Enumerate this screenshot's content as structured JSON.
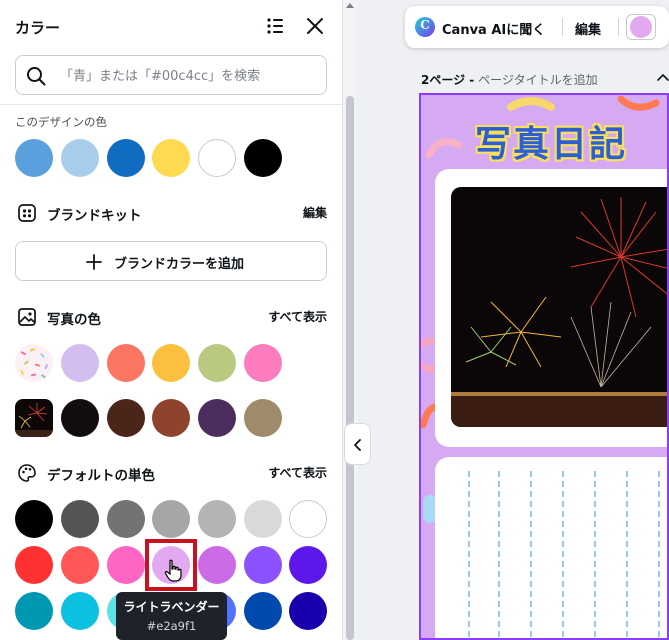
{
  "panel": {
    "title": "カラー",
    "search_placeholder": "「青」または「#00c4cc」を検索",
    "design_colors": {
      "caption": "このデザインの色",
      "colors": [
        "#5aa0dc",
        "#a8cdeb",
        "#0f6cc0",
        "#fdda4f",
        "#ffffff",
        "#000000"
      ]
    },
    "brand_kit": {
      "title": "ブランドキット",
      "edit": "編集",
      "add_button": "ブランドカラーを追加"
    },
    "photo_colors": {
      "title": "写真の色",
      "show_all": "すべて表示",
      "row1": [
        "#d2bff0",
        "#fc7462",
        "#fcbf3e",
        "#b9c97f",
        "#fd7cbd"
      ],
      "row2": [
        "#120c0c",
        "#4b2519",
        "#8f432c",
        "#4b2e5d",
        "#9f8a6c"
      ]
    },
    "default_colors": {
      "title": "デフォルトの単色",
      "show_all": "すべて表示",
      "row1": [
        "#000000",
        "#545454",
        "#737373",
        "#a6a6a6",
        "#b4b4b4",
        "#d9d9d9",
        "#ffffff"
      ],
      "row2": [
        "#ff3131",
        "#ff5757",
        "#ff66c4",
        "#e2a9f1",
        "#cb6ce6",
        "#8c52ff",
        "#5e17eb"
      ],
      "row3": [
        "#0097b2",
        "#0cc0df",
        "#5ce1e6",
        "#38b6ff",
        "#5271ff",
        "#004aad",
        "#1800ad"
      ]
    },
    "tooltip": {
      "name": "ライトラベンダー",
      "hex": "#e2a9f1"
    }
  },
  "toolbar": {
    "ai_label": "Canva AIに聞く",
    "edit_label": "編集",
    "current_color": "#e2a9f1"
  },
  "page": {
    "number_label": "2ページ -",
    "title_placeholder": "ページタイトルを追加",
    "heading": "写真日記",
    "background": "#d6aaf2"
  }
}
